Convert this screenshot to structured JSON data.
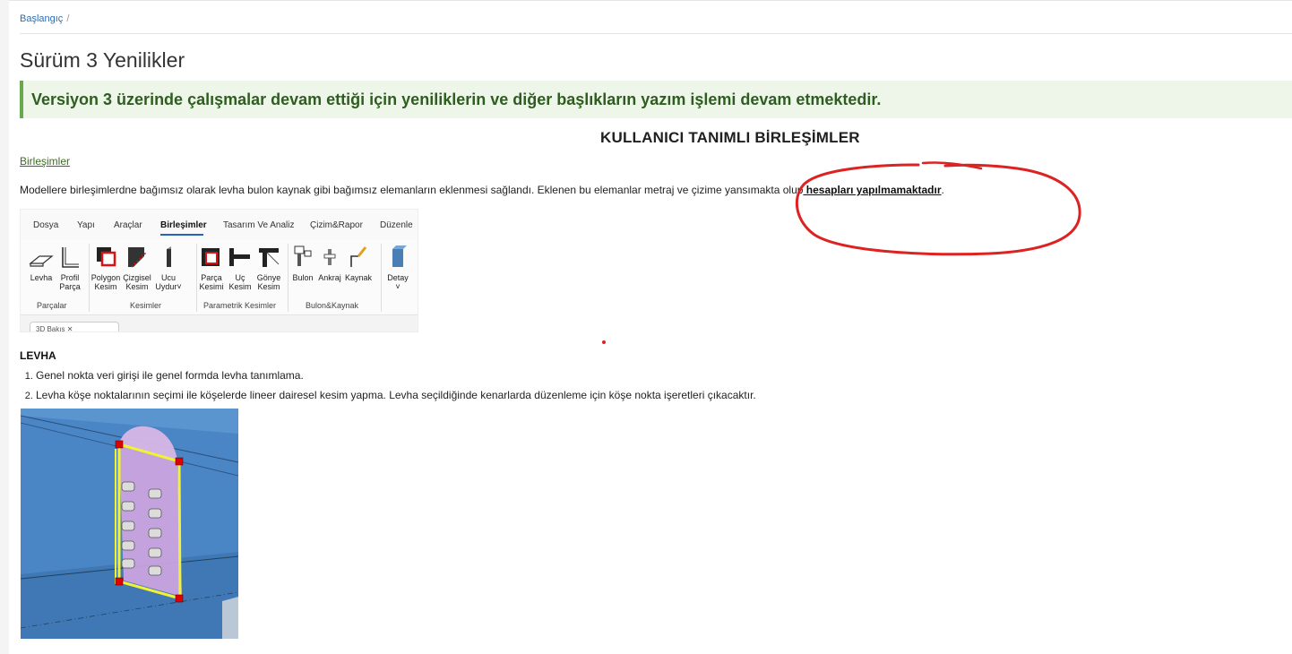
{
  "breadcrumb": {
    "home": "Başlangıç",
    "separator": "/"
  },
  "page": {
    "title": "Sürüm 3 Yenilikler"
  },
  "notice": {
    "text": "Versiyon 3 üzerinde çalışmalar devam ettiği için yeniliklerin ve diğer başlıkların yazım işlemi devam etmektedir."
  },
  "section": {
    "heading": "KULLANICI TANIMLI BİRLEŞİMLER"
  },
  "link": {
    "birlesimler": "Birleşimler"
  },
  "paragraph": {
    "text": "Modellere birleşimlerdne bağımsız olarak levha bulon kaynak gibi bağımsız elemanların eklenmesi sağlandı. Eklenen bu elemanlar metraj ve çizime yansımakta olup",
    "bold": " hesapları yapılmamaktadır",
    "end": "."
  },
  "ribbon": {
    "tabs": [
      "Dosya",
      "Yapı",
      "Araçlar",
      "Birleşimler",
      "Tasarım Ve Analiz",
      "Çizim&Rapor",
      "Düzenle"
    ],
    "active_tab": "Birleşimler",
    "buttons": {
      "levha": "Levha",
      "profil": [
        "Profil",
        "Parça"
      ],
      "polygon": [
        "Polygon",
        "Kesim"
      ],
      "cizgisel": [
        "Çizgisel",
        "Kesim"
      ],
      "ucu": [
        "Ucu",
        "Uydur"
      ],
      "parca": [
        "Parça",
        "Kesimi"
      ],
      "uc": [
        "Uç",
        "Kesim"
      ],
      "gonye": [
        "Gönye",
        "Kesim"
      ],
      "bulon": "Bulon",
      "ankraj": "Ankraj",
      "kaynak": "Kaynak",
      "detay": "Detay"
    },
    "groups": {
      "parcalar": "Parçalar",
      "kesimler": "Kesimler",
      "parametrik": "Parametrik Kesimler",
      "bulon_kaynak": "Bulon&Kaynak"
    },
    "foot_pill": "3D Bakış"
  },
  "levha": {
    "title": "LEVHA",
    "items": [
      "Genel nokta veri girişi ile genel formda levha tanımlama.",
      "Levha köşe noktalarının seçimi ile köşelerde lineer dairesel kesim yapma.  Levha seçildiğinde kenarlarda düzenleme için köşe nokta işeretleri çıkacaktır."
    ]
  },
  "colors": {
    "accent": "#2563b8",
    "notice_bg": "#eef6ea",
    "notice_border": "#6aa84f",
    "annotation": "#dd2222"
  }
}
